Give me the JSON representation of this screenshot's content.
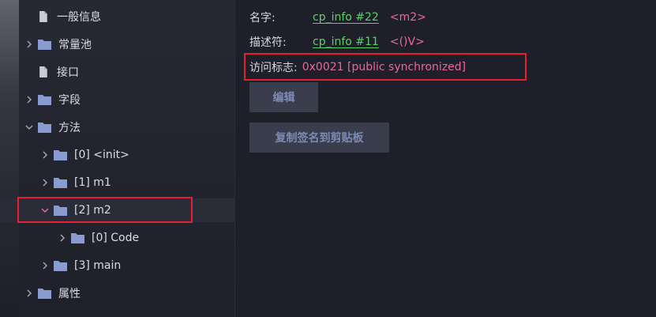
{
  "tree": {
    "items": [
      {
        "label": "一般信息",
        "type": "file",
        "arrow": "none"
      },
      {
        "label": "常量池",
        "type": "folder",
        "arrow": "right"
      },
      {
        "label": "接口",
        "type": "file",
        "arrow": "none"
      },
      {
        "label": "字段",
        "type": "folder",
        "arrow": "right"
      },
      {
        "label": "方法",
        "type": "folder",
        "arrow": "down"
      },
      {
        "label": "[0] <init>",
        "type": "folder",
        "arrow": "right"
      },
      {
        "label": "[1] m1",
        "type": "folder",
        "arrow": "right"
      },
      {
        "label": "[2] m2",
        "type": "folder",
        "arrow": "down",
        "selected": true
      },
      {
        "label": "[0] Code",
        "type": "folder",
        "arrow": "right"
      },
      {
        "label": "[3] main",
        "type": "folder",
        "arrow": "right"
      },
      {
        "label": "属性",
        "type": "folder",
        "arrow": "right"
      }
    ]
  },
  "detail": {
    "name_key": "名字:",
    "name_link": "cp_info #22",
    "name_value": "<m2>",
    "desc_key": "描述符:",
    "desc_link": "cp_info #11",
    "desc_value": "<()V>",
    "access_key": "访问标志:",
    "access_value": "0x0021 [public synchronized]",
    "edit_button": "编辑",
    "copy_button": "复制签名到剪贴板"
  },
  "colors": {
    "link": "#5bd06a",
    "value": "#e667a6",
    "highlight_box": "#e5202e",
    "folder": "#8a9bd0"
  }
}
